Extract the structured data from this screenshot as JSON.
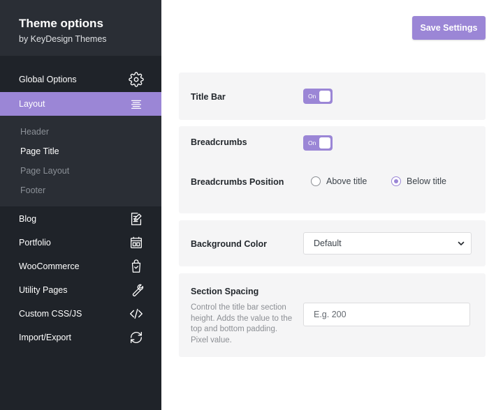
{
  "brand": {
    "title": "Theme options",
    "subtitle": "by KeyDesign Themes"
  },
  "sidebar": {
    "items": [
      {
        "label": "Global Options",
        "icon": "gear-icon"
      },
      {
        "label": "Layout",
        "icon": "align-justify-icon",
        "active": true
      },
      {
        "label": "Blog",
        "icon": "edit-document-icon"
      },
      {
        "label": "Portfolio",
        "icon": "portfolio-icon"
      },
      {
        "label": "WooCommerce",
        "icon": "shopping-bag-icon"
      },
      {
        "label": "Utility Pages",
        "icon": "wrench-icon"
      },
      {
        "label": "Custom CSS/JS",
        "icon": "code-icon"
      },
      {
        "label": "Import/Export",
        "icon": "sync-icon"
      }
    ],
    "submenu": [
      {
        "label": "Header"
      },
      {
        "label": "Page Title",
        "current": true
      },
      {
        "label": "Page Layout"
      },
      {
        "label": "Footer"
      }
    ]
  },
  "toolbar": {
    "save_label": "Save Settings"
  },
  "settings": {
    "title_bar": {
      "label": "Title Bar",
      "toggle_text": "On"
    },
    "breadcrumbs": {
      "label": "Breadcrumbs",
      "toggle_text": "On"
    },
    "breadcrumbs_position": {
      "label": "Breadcrumbs Position",
      "options": [
        "Above title",
        "Below title"
      ],
      "selected": "Below title"
    },
    "background_color": {
      "label": "Background Color",
      "value": "Default"
    },
    "section_spacing": {
      "label": "Section Spacing",
      "help": "Control the title bar section height. Adds the value to the top and bottom padding. Pixel value.",
      "placeholder": "E.g. 200"
    }
  },
  "colors": {
    "accent": "#9b86d6",
    "sidebar_bg": "#1f2329",
    "panel_bg": "#f5f5f6"
  }
}
